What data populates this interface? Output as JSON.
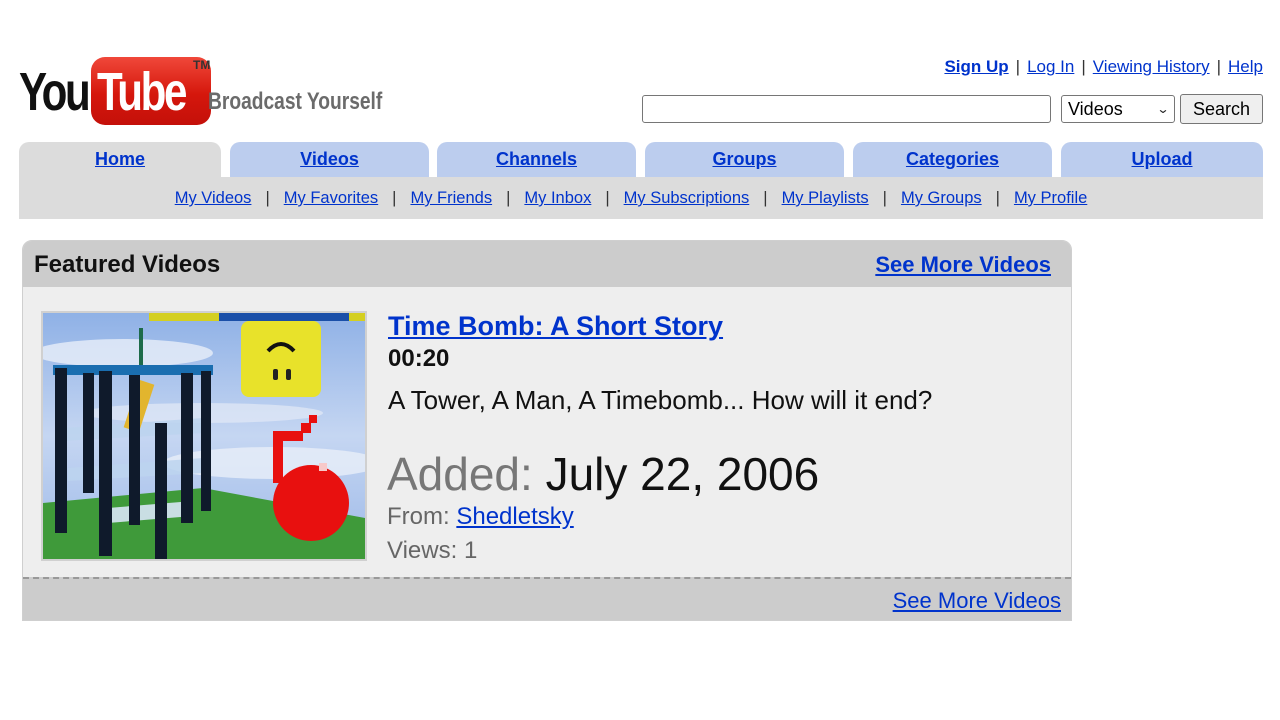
{
  "logo": {
    "brand_left": "You",
    "brand_right": "Tube",
    "trademark": "TM",
    "tagline": "Broadcast Yourself"
  },
  "util_links": [
    {
      "label": "Sign Up"
    },
    {
      "label": "Log In"
    },
    {
      "label": "Viewing History"
    },
    {
      "label": "Help"
    }
  ],
  "util_separator": "|",
  "search": {
    "value": "",
    "placeholder": "",
    "scope_selected": "Videos",
    "scope_chevron": "⌄",
    "button_label": "Search"
  },
  "tabs": [
    {
      "label": "Home",
      "active": true
    },
    {
      "label": "Videos"
    },
    {
      "label": "Channels"
    },
    {
      "label": "Groups"
    },
    {
      "label": "Categories"
    },
    {
      "label": "Upload"
    }
  ],
  "subnav": {
    "separator": "|",
    "items": [
      {
        "label": "My Videos"
      },
      {
        "label": "My Favorites"
      },
      {
        "label": "My Friends"
      },
      {
        "label": "My Inbox"
      },
      {
        "label": "My Subscriptions"
      },
      {
        "label": "My Playlists"
      },
      {
        "label": "My Groups"
      },
      {
        "label": "My Profile"
      }
    ]
  },
  "featured": {
    "title": "Featured Videos",
    "see_more_top": "See More Videos",
    "see_more_bottom": "See More Videos",
    "video": {
      "title": "Time Bomb: A Short Story",
      "duration": "00:20",
      "description": "A Tower, A Man, A Timebomb... How will it end?",
      "added_label": "Added:",
      "added_value": "July 22, 2006",
      "from_label": "From:",
      "from_user": "Shedletsky",
      "views_label": "Views:",
      "views_value": "1",
      "thumbnail_alt": "Tower with figure and red bomb"
    }
  },
  "colors": {
    "link": "#0033cc",
    "tab_inactive": "#bccdee",
    "tab_active": "#dcdcdc",
    "panel_header": "#cccccc",
    "panel_body": "#eeeeee",
    "logo_red": "#d5170c"
  }
}
